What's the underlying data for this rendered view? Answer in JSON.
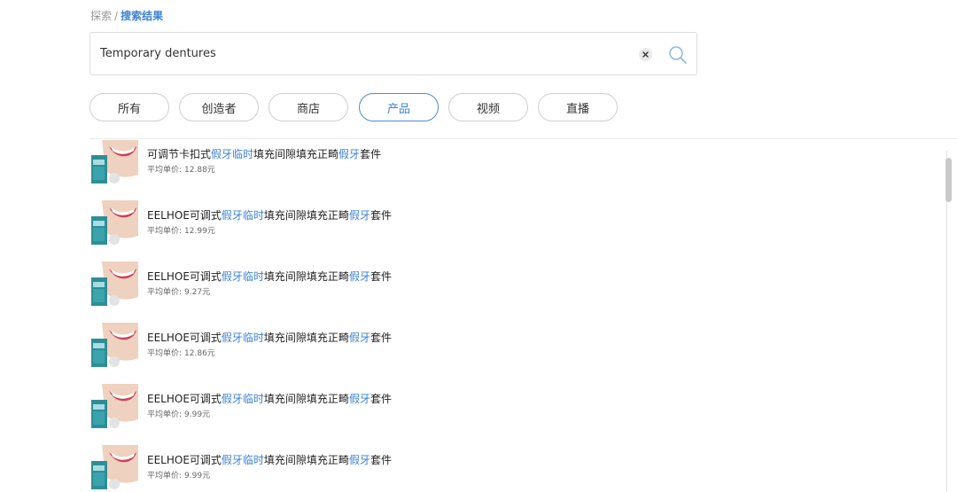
{
  "breadcrumb": {
    "parent": "探索",
    "separator": "/",
    "current": "搜索结果"
  },
  "search": {
    "value": "Temporary dentures",
    "clear_icon": "close-icon",
    "search_icon": "search-icon"
  },
  "tabs": [
    {
      "label": "所有",
      "active": false
    },
    {
      "label": "创造者",
      "active": false
    },
    {
      "label": "商店",
      "active": false
    },
    {
      "label": "产品",
      "active": true
    },
    {
      "label": "视频",
      "active": false
    },
    {
      "label": "直播",
      "active": false
    }
  ],
  "colors": {
    "accent": "#3b82d6",
    "border": "#dcdcdc",
    "text": "#222222"
  },
  "products": [
    {
      "title": [
        {
          "t": "可调节卡扣式"
        },
        {
          "t": "假牙临时",
          "hl": true
        },
        {
          "t": "填充间隙填充正畸"
        },
        {
          "t": "假牙",
          "hl": true
        },
        {
          "t": "套件"
        }
      ],
      "price_label": "平均单价:",
      "price": "12.88元"
    },
    {
      "title": [
        {
          "t": "EELHOE可调式"
        },
        {
          "t": "假牙临时",
          "hl": true
        },
        {
          "t": "填充间隙填充正畸"
        },
        {
          "t": "假牙",
          "hl": true
        },
        {
          "t": "套件"
        }
      ],
      "price_label": "平均单价:",
      "price": "12.99元"
    },
    {
      "title": [
        {
          "t": "EELHOE可调式"
        },
        {
          "t": "假牙临时",
          "hl": true
        },
        {
          "t": "填充间隙填充正畸"
        },
        {
          "t": "假牙",
          "hl": true
        },
        {
          "t": "套件"
        }
      ],
      "price_label": "平均单价:",
      "price": "9.27元"
    },
    {
      "title": [
        {
          "t": "EELHOE可调式"
        },
        {
          "t": "假牙临时",
          "hl": true
        },
        {
          "t": "填充间隙填充正畸"
        },
        {
          "t": "假牙",
          "hl": true
        },
        {
          "t": "套件"
        }
      ],
      "price_label": "平均单价:",
      "price": "12.86元"
    },
    {
      "title": [
        {
          "t": "EELHOE可调式"
        },
        {
          "t": "假牙临时",
          "hl": true
        },
        {
          "t": "填充间隙填充正畸"
        },
        {
          "t": "假牙",
          "hl": true
        },
        {
          "t": "套件"
        }
      ],
      "price_label": "平均单价:",
      "price": "9.99元"
    },
    {
      "title": [
        {
          "t": "EELHOE可调式"
        },
        {
          "t": "假牙临时",
          "hl": true
        },
        {
          "t": "填充间隙填充正畸"
        },
        {
          "t": "假牙",
          "hl": true
        },
        {
          "t": "套件"
        }
      ],
      "price_label": "平均单价:",
      "price": "9.99元"
    }
  ]
}
